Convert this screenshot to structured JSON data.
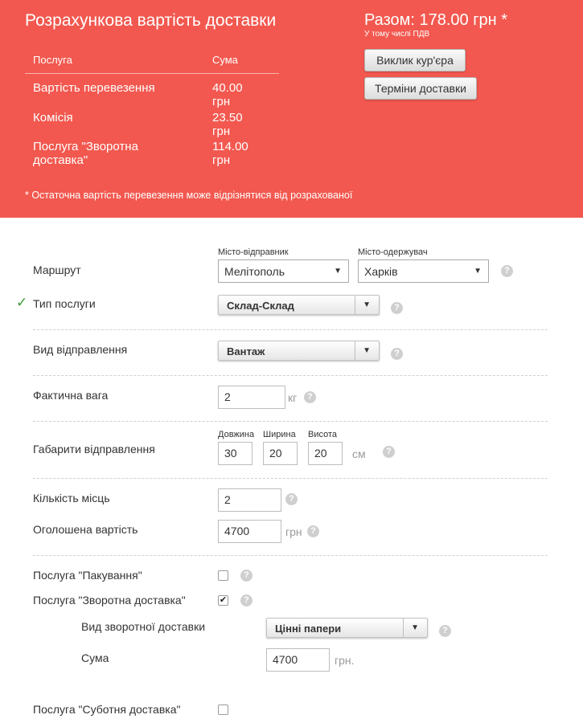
{
  "header": {
    "title": "Розрахункова вартість доставки",
    "table": {
      "col_service": "Послуга",
      "col_sum": "Сума",
      "rows": [
        {
          "service": "Вартість перевезення",
          "sum": "40.00 грн"
        },
        {
          "service": "Комісія",
          "sum": "23.50 грн"
        },
        {
          "service": "Послуга \"Зворотна доставка\"",
          "sum": "114.00 грн"
        }
      ]
    },
    "note": "* Остаточна вартість перевезення може відрізнятися від розрахованої",
    "total": "Разом: 178.00 грн *",
    "vat": "У тому числі ПДВ",
    "courier_button": "Виклик кур'єра",
    "terms_button": "Терміни доставки",
    "bg_color": "#f2584f"
  },
  "form": {
    "route": {
      "label": "Маршрут",
      "sender_label": "Місто-відправник",
      "sender_value": "Мелітополь",
      "receiver_label": "Місто-одержувач",
      "receiver_value": "Харків"
    },
    "service_type": {
      "label": "Тип послуги",
      "value": "Склад-Склад"
    },
    "shipment_type": {
      "label": "Вид відправлення",
      "value": "Вантаж"
    },
    "weight": {
      "label": "Фактична вага",
      "value": "2",
      "unit": "кг"
    },
    "dimensions": {
      "label": "Габарити відправлення",
      "length_label": "Довжина",
      "length": "30",
      "width_label": "Ширина",
      "width": "20",
      "height_label": "Висота",
      "height": "20",
      "unit": "см"
    },
    "places": {
      "label": "Кількість місць",
      "value": "2"
    },
    "declared_value": {
      "label": "Оголошена вартість",
      "value": "4700",
      "unit": "грн"
    },
    "packing": {
      "label": "Послуга \"Пакування\"",
      "checked": false
    },
    "return_delivery": {
      "label": "Послуга \"Зворотна доставка\"",
      "checked": true,
      "check_mark": "✔"
    },
    "return_type": {
      "label": "Вид зворотної доставки",
      "value": "Цінні папери"
    },
    "return_sum": {
      "label": "Сума",
      "value": "4700",
      "unit": "грн."
    },
    "saturday": {
      "label": "Послуга \"Суботня доставка\"",
      "checked": false
    },
    "help_glyph": "?",
    "arrow_glyph": "▼",
    "valid_mark": "✓"
  }
}
